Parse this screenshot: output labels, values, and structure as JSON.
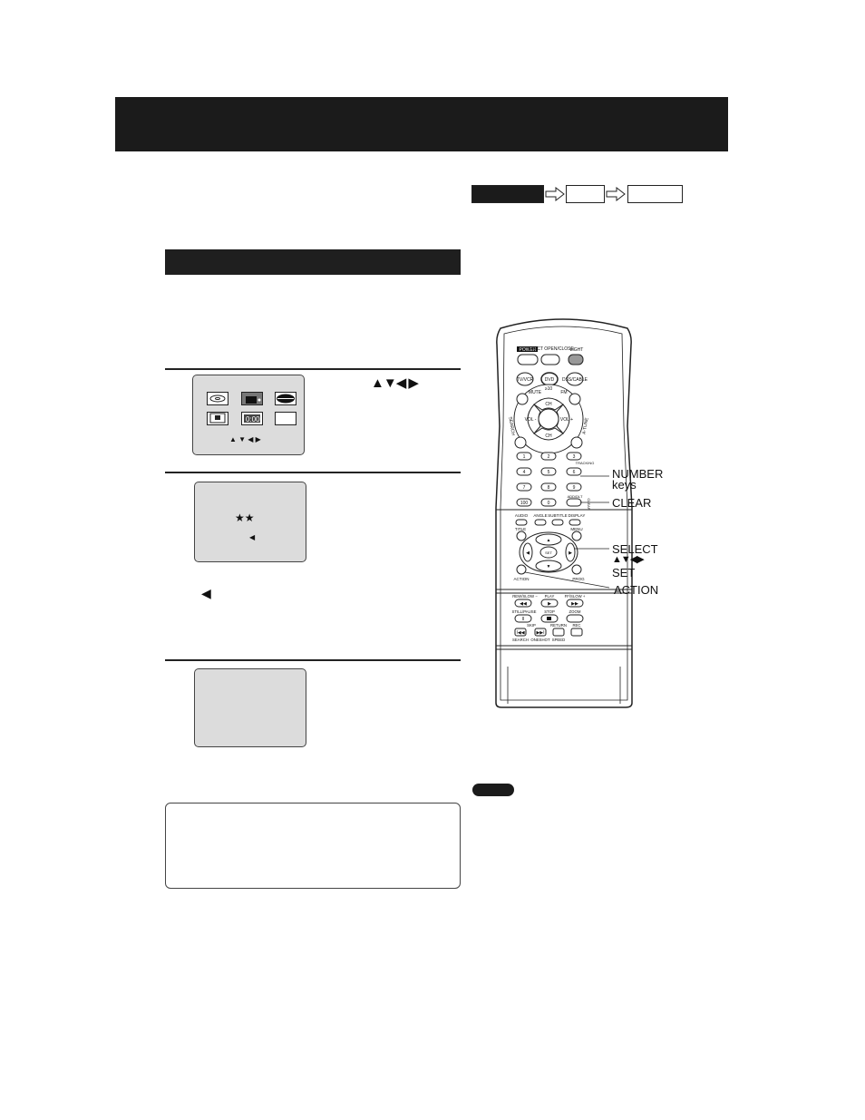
{
  "flow": {
    "arrow_icon": "hollow-right-arrow-icon"
  },
  "step1": {
    "instruction_arrows": "▲▼◀ ▶",
    "screen_arrows": "▲ ▼ ◀ ▶",
    "icons": [
      "disc-icon",
      "tv-icon",
      "lips-icon",
      "rating-icon",
      "display-icon",
      "blank-icon"
    ]
  },
  "step2": {
    "screen_stars": "★★",
    "screen_cursor": "◀",
    "below_cursor": "◀"
  },
  "remote": {
    "top": {
      "power": "POWER",
      "eject": "EJECT\nOPEN/CLOSE",
      "light": "LIGHT",
      "tvvcr": "TV/VCR",
      "dvd": "DVD",
      "dss": "DSS/CABLE"
    },
    "ring": {
      "mute": "MUTE",
      "ge10": "≥10",
      "fm": "FM",
      "ch_up": "CH",
      "ch_down": "CH",
      "vol_minus": "VOL -",
      "vol_plus": "VOL +",
      "left": "SEARCH",
      "right": "A-TUNE"
    },
    "number_keys": [
      "1",
      "2",
      "3",
      "4",
      "5",
      "6",
      "7",
      "8",
      "9",
      "100",
      "0",
      ""
    ],
    "tracking": "TRACKING",
    "add_dlt": "ADD/DLT",
    "clear_side": "CLEAR",
    "func_labels": [
      "AUDIO",
      "ANGLE",
      "SUBTITLE",
      "DISPLAY"
    ],
    "title": "TITLE",
    "menu": "MENU",
    "set": "SET",
    "action": "ACTION",
    "prog": "PROG",
    "transport_labels": [
      "REW/SLOW −",
      "PLAY",
      "FF/SLOW +",
      "STILL/PAUSE",
      "STOP",
      "ZOOM",
      "SKIP",
      "RETURN",
      "REC",
      "SEARCH",
      "ONESHOT",
      "SPEED"
    ]
  },
  "callouts": {
    "number": "NUMBER",
    "keys": "keys",
    "clear": "CLEAR",
    "select": "SELECT",
    "select_arrows": "▲▼◀▶",
    "set": "SET",
    "action": "ACTION"
  }
}
